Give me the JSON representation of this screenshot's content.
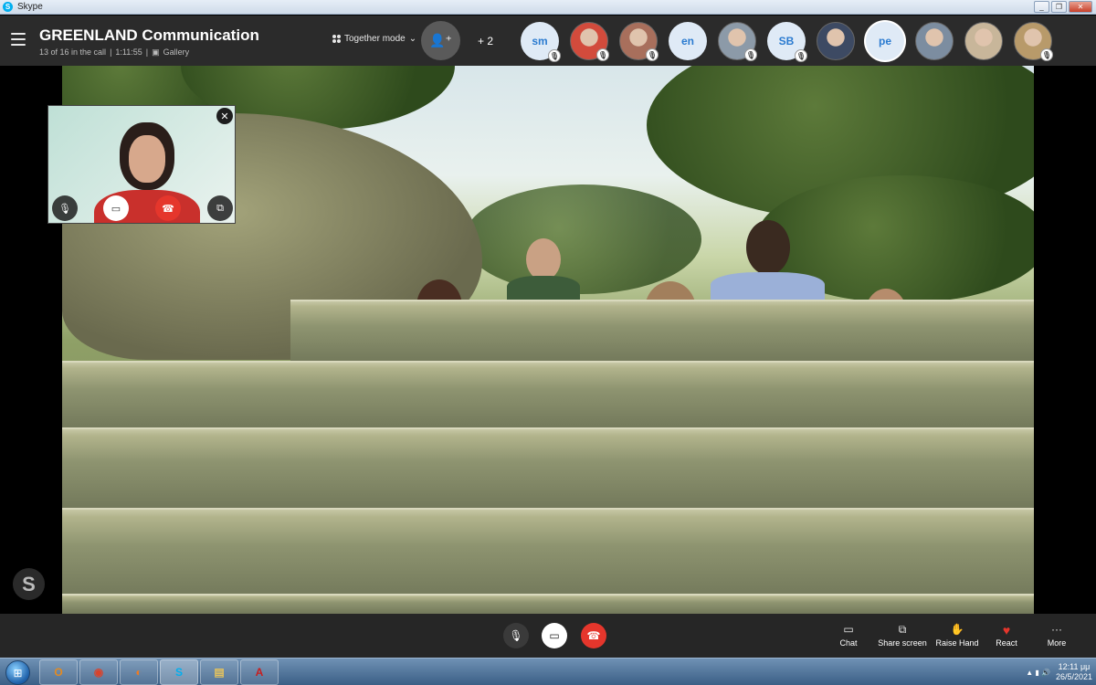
{
  "window": {
    "title": "Skype",
    "min": "_",
    "max": "❐",
    "close": "✕"
  },
  "call": {
    "title": "GREENLAND Communication",
    "participants_status": "13 of 16 in the call",
    "separator1": "|",
    "duration": "1:11:55",
    "separator2": "|",
    "view_mode": "Gallery",
    "together_mode_label": "Together mode",
    "together_mode_chevron": "⌄",
    "more_participants": "+ 2"
  },
  "participants": [
    {
      "label": "sm",
      "kind": "initials",
      "muted": true
    },
    {
      "label": "",
      "kind": "photo",
      "color": "#d24b3c",
      "muted": true
    },
    {
      "label": "",
      "kind": "photo",
      "color": "#a86f5c",
      "muted": true
    },
    {
      "label": "en",
      "kind": "initials",
      "muted": false
    },
    {
      "label": "",
      "kind": "photo",
      "color": "#8c9aa8",
      "muted": true
    },
    {
      "label": "SB",
      "kind": "initials",
      "muted": true
    },
    {
      "label": "",
      "kind": "photo",
      "color": "#3d4a63",
      "muted": false
    },
    {
      "label": "pe",
      "kind": "initials",
      "muted": false,
      "selected": true
    },
    {
      "label": "",
      "kind": "photo",
      "color": "#7c8da0",
      "muted": false
    },
    {
      "label": "",
      "kind": "photo",
      "color": "#c8b69a",
      "muted": false
    },
    {
      "label": "",
      "kind": "photo",
      "color": "#b89a6a",
      "muted": true
    }
  ],
  "self_view": {
    "close": "✕",
    "mute": "🎙",
    "video": "▭",
    "hangup": "☎",
    "popout": "⧉"
  },
  "controls": {
    "mute": "🎙",
    "video": "▭",
    "hangup": "☎",
    "actions": [
      {
        "label": "Chat",
        "icon": "▭"
      },
      {
        "label": "Share screen",
        "icon": "⧉"
      },
      {
        "label": "Raise Hand",
        "icon": "✋"
      },
      {
        "label": "React",
        "icon": "♥"
      },
      {
        "label": "More",
        "icon": "···"
      }
    ]
  },
  "taskbar": {
    "items": [
      {
        "icon": "O",
        "color": "#e58a1f"
      },
      {
        "icon": "◉",
        "color": "#d9432c"
      },
      {
        "icon": "◐",
        "color": "#f07b21"
      },
      {
        "icon": "S",
        "color": "#00aff0"
      },
      {
        "icon": "▤",
        "color": "#e6c35c"
      },
      {
        "icon": "A",
        "color": "#c81e1e"
      }
    ],
    "tray_icons": "▲ ▮ 🔊",
    "time": "12:11 μμ",
    "date": "26/5/2021"
  },
  "colors": {
    "accent": "#00aff0",
    "hangup": "#e5362c",
    "topbar": "#2b2b2b"
  }
}
